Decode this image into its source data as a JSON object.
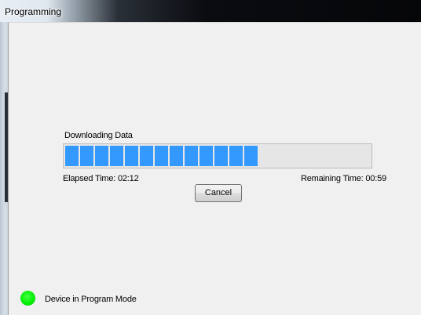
{
  "window": {
    "title": "Programming"
  },
  "download": {
    "heading": "Downloading Data",
    "progress": {
      "filled_segments": 13,
      "fraction": 0.64,
      "color": "#3399ff"
    },
    "elapsed": "Elapsed Time: 02:12",
    "remaining": "Remaining Time: 00:59",
    "cancel_label": "Cancel"
  },
  "status": {
    "text": "Device in Program Mode",
    "led_color": "#00ee00"
  }
}
